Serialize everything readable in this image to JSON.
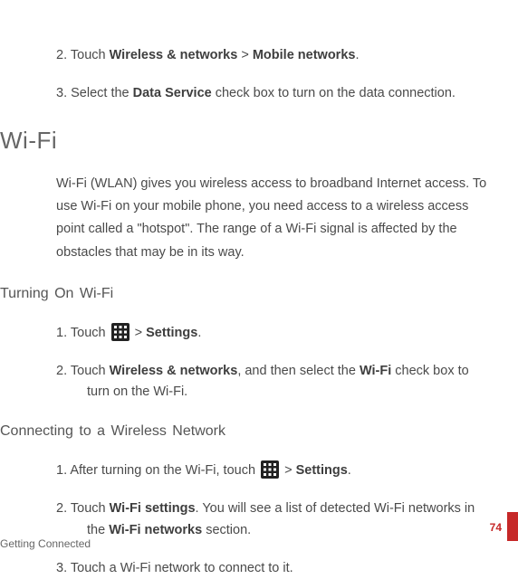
{
  "prev_steps": {
    "s2_num": "2.",
    "s2_a": "Touch ",
    "s2_b": "Wireless & networks",
    "s2_c": " > ",
    "s2_d": "Mobile networks",
    "s2_e": ".",
    "s3_num": "3.",
    "s3_a": "Select the ",
    "s3_b": "Data Service",
    "s3_c": " check box to turn on the data connection."
  },
  "wifi": {
    "heading": "Wi-Fi",
    "para": "Wi-Fi (WLAN) gives you wireless access to broadband Internet access. To use Wi-Fi on your mobile phone, you need access to a wireless access point called a \"hotspot\". The range of a Wi-Fi signal is affected by the obstacles that may be in its way."
  },
  "turning_on": {
    "heading": "Turning On Wi-Fi",
    "s1_num": "1.",
    "s1_a": "Touch ",
    "s1_b": " > ",
    "s1_c": "Settings",
    "s1_d": ".",
    "s2_num": "2.",
    "s2_a": "Touch ",
    "s2_b": "Wireless & networks",
    "s2_c": ", and then select the ",
    "s2_d": "Wi-Fi",
    "s2_e": " check box to",
    "s2_f": "turn on the Wi-Fi."
  },
  "connecting": {
    "heading": "Connecting to a Wireless Network",
    "s1_num": "1.",
    "s1_a": "After turning on the Wi-Fi, touch ",
    "s1_b": " > ",
    "s1_c": "Settings",
    "s1_d": ".",
    "s2_num": "2.",
    "s2_a": "Touch ",
    "s2_b": "Wi-Fi settings",
    "s2_c": ". You will see a list of detected Wi-Fi networks in",
    "s2_d": "the ",
    "s2_e": "Wi-Fi networks",
    "s2_f": " section.",
    "s3_num": "3.",
    "s3_a": "Touch a Wi-Fi network to connect to it."
  },
  "footer": "Getting Connected",
  "page_num": "74"
}
